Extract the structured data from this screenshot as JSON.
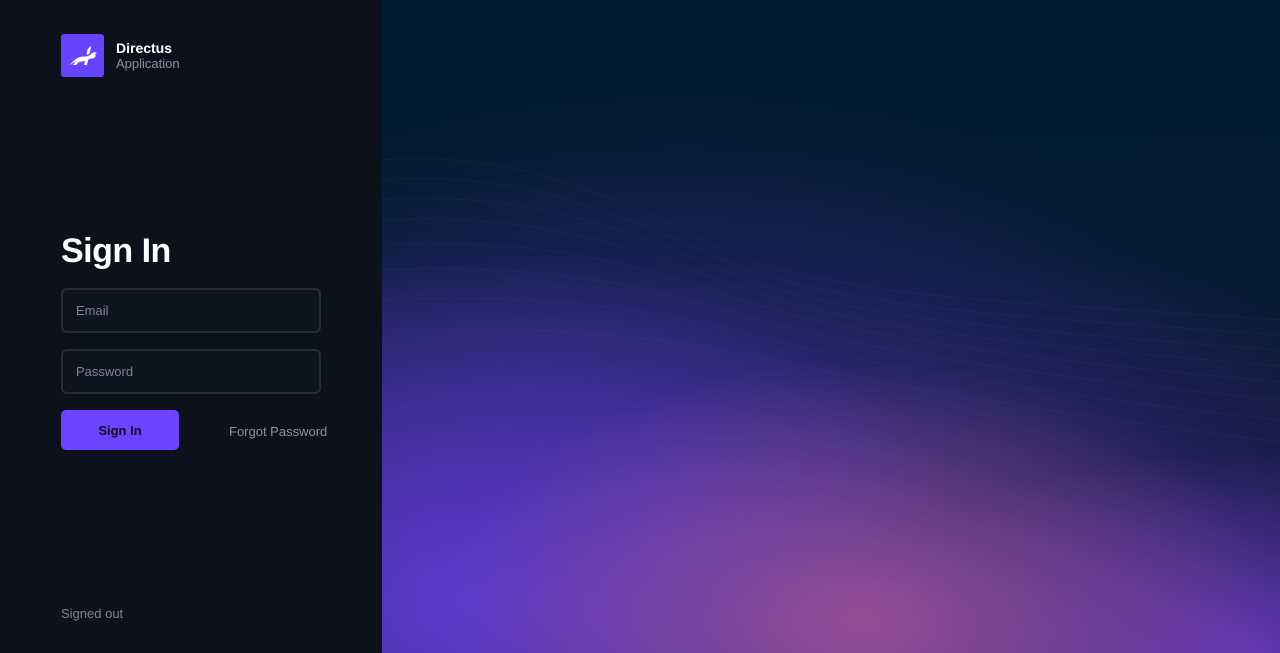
{
  "app": {
    "name": "Directus",
    "subtitle": "Application"
  },
  "login": {
    "title": "Sign In",
    "email_placeholder": "Email",
    "password_placeholder": "Password",
    "submit_label": "Sign In",
    "forgot_label": "Forgot Password"
  },
  "status": {
    "text": "Signed out"
  },
  "icons": {
    "logo": "rabbit-icon"
  },
  "colors": {
    "accent": "#6644ff",
    "background": "#0c111b",
    "hero_background": "#021a2e"
  }
}
